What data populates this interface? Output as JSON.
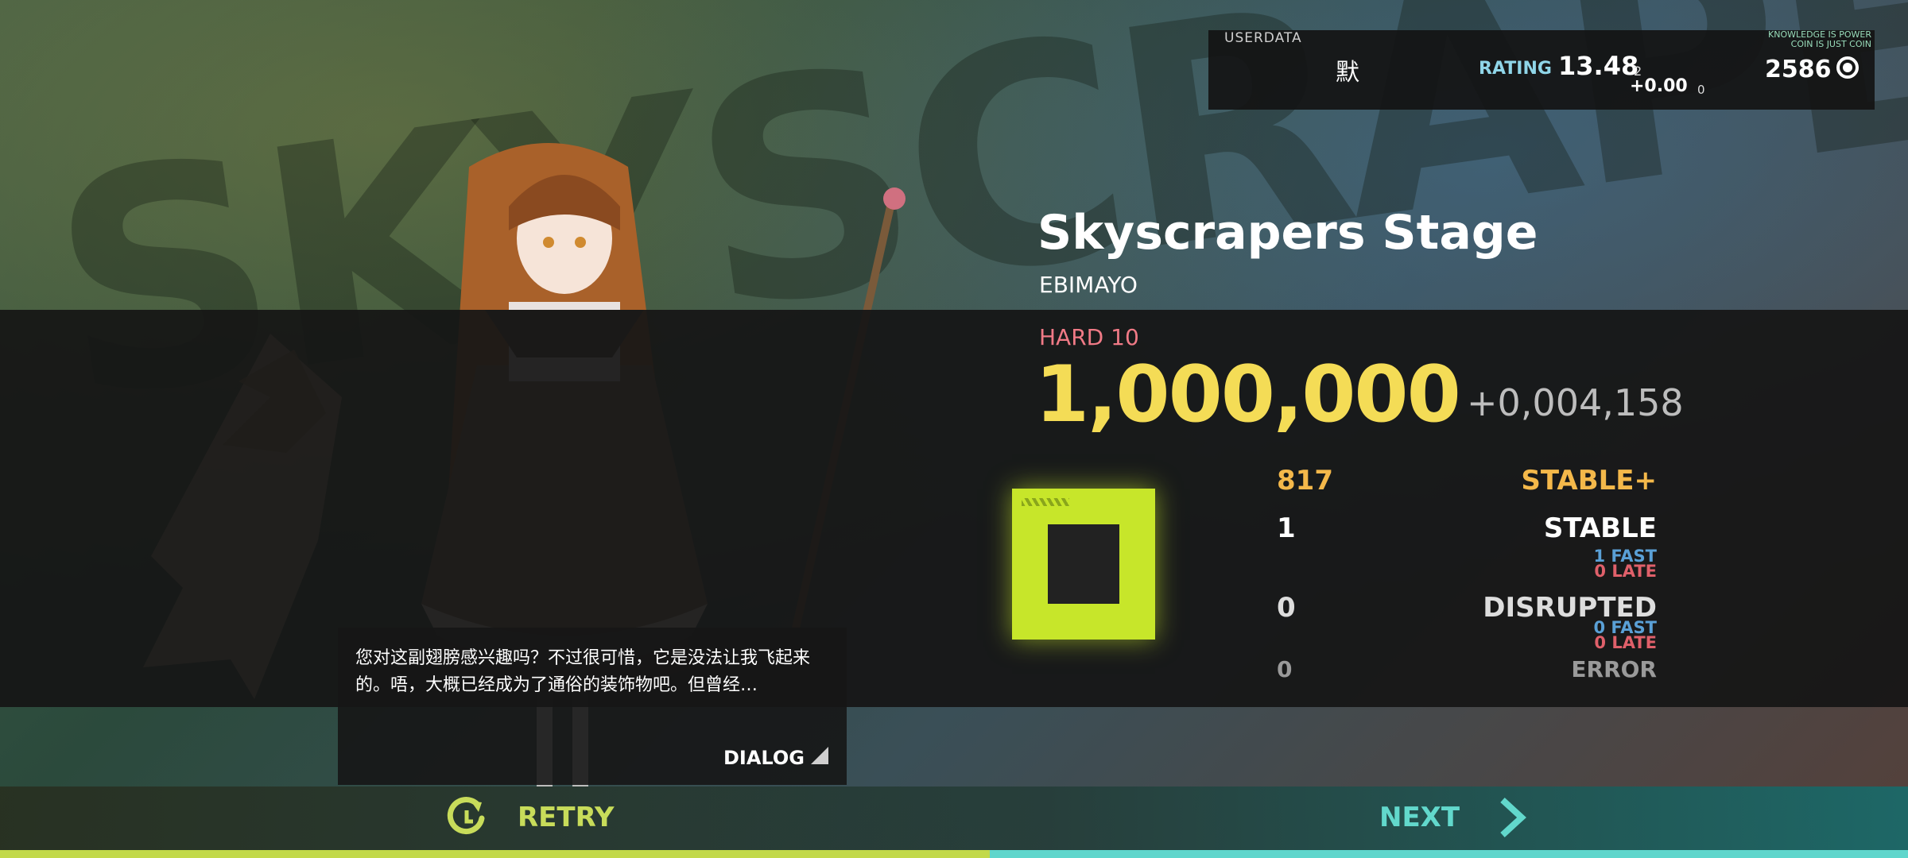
{
  "background": {
    "lettering": "SKYSCRAPER"
  },
  "userpanel": {
    "userdata_label": "USERDATA",
    "username": "默",
    "rating_label": "RATING",
    "rating_value": "13.48",
    "rating_sub": "2",
    "rating_delta": "+0.00",
    "rating_delta_sub": "0",
    "coin_tagline_line1": "KNOWLEDGE IS POWER",
    "coin_tagline_line2": "COIN IS JUST COIN",
    "coins": "2586"
  },
  "song": {
    "title": "Skyscrapers Stage",
    "artist": "EBIMAYO",
    "difficulty": "HARD 10",
    "score": "1,000,000",
    "score_delta": "+0,004,158"
  },
  "judgements": {
    "stable_plus": {
      "count": "817",
      "label": "STABLE+"
    },
    "stable": {
      "count": "1",
      "label": "STABLE",
      "fast": "1 FAST",
      "late": "0 LATE"
    },
    "disrupted": {
      "count": "0",
      "label": "DISRUPTED",
      "fast": "0 FAST",
      "late": "0 LATE"
    },
    "error": {
      "count": "0",
      "label": "ERROR"
    }
  },
  "dialog": {
    "text": "您对这副翅膀感兴趣吗？不过很可惜，它是没法让我飞起来的。唔，大概已经成为了通俗的装饰物吧。但曾经…",
    "button_label": "DIALOG"
  },
  "actions": {
    "retry_label": "RETRY",
    "next_label": "NEXT"
  },
  "colors": {
    "score": "#f4dc56",
    "stable_plus": "#f4b84a",
    "difficulty": "#f07a86",
    "grade": "#c7e62a",
    "retry": "#c8dc5a",
    "next": "#62d8cc",
    "fast": "#5aa0d6",
    "late": "#e0606a"
  },
  "icons": {
    "retry": "retry-icon",
    "next": "chevron-right-icon",
    "coin": "coin-icon",
    "grade": "grade-emblem"
  }
}
